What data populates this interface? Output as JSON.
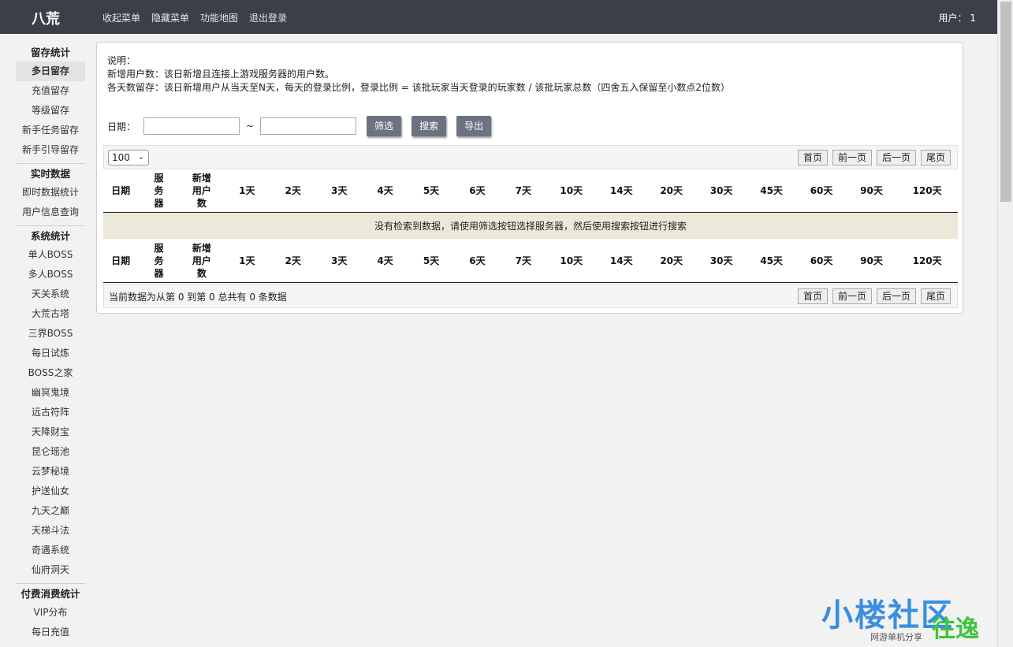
{
  "app": {
    "brand": "八荒"
  },
  "topnav": [
    "收起菜单",
    "隐藏菜单",
    "功能地图",
    "退出登录"
  ],
  "user": {
    "label": "用户：",
    "value": "1"
  },
  "sidebar": [
    {
      "title": "留存统计",
      "items": [
        "多日留存",
        "充值留存",
        "等级留存",
        "新手任务留存",
        "新手引导留存"
      ]
    },
    {
      "title": "实时数据",
      "items": [
        "即时数据统计",
        "用户信息查询"
      ]
    },
    {
      "title": "系统统计",
      "items": [
        "单人BOSS",
        "多人BOSS",
        "天关系统",
        "大荒古塔",
        "三界BOSS",
        "每日试炼",
        "BOSS之家",
        "幽冥鬼境",
        "远古符阵",
        "天降财宝",
        "昆仑瑶池",
        "云梦秘境",
        "护送仙女",
        "九天之巅",
        "天梯斗法",
        "奇遇系统",
        "仙府洞天"
      ]
    },
    {
      "title": "付费消费统计",
      "items": [
        "VIP分布",
        "每日充值"
      ]
    }
  ],
  "active_item": "多日留存",
  "description": {
    "heading": "说明：",
    "line1": "新增用户数：该日新增且连接上游戏服务器的用户数。",
    "line2": "各天数留存：该日新增用户从当天至N天，每天的登录比例，登录比例 = 该批玩家当天登录的玩家数 / 该批玩家总数（四舍五入保留至小数点2位数）"
  },
  "filter": {
    "date_label": "日期：",
    "tilde": "~",
    "start_value": "",
    "end_value": "",
    "buttons": {
      "filter": "筛选",
      "search": "搜索",
      "export": "导出"
    }
  },
  "table": {
    "page_size": "100",
    "pager": {
      "first": "首页",
      "prev": "前一页",
      "next": "后一页",
      "last": "尾页"
    },
    "columns": [
      "日期",
      "服\n务\n器",
      "新增\n用户\n数",
      "1天",
      "2天",
      "3天",
      "4天",
      "5天",
      "6天",
      "7天",
      "10天",
      "14天",
      "20天",
      "30天",
      "45天",
      "60天",
      "90天",
      "120天"
    ],
    "empty_message": "没有检索到数据，请使用筛选按钮选择服务器，然后使用搜索按钮进行搜索",
    "info": "当前数据为从第 0 到第 0 总共有 0 条数据"
  },
  "watermark": {
    "main": "小楼社区",
    "sub": "网游单机分享",
    "green": "往逸"
  }
}
